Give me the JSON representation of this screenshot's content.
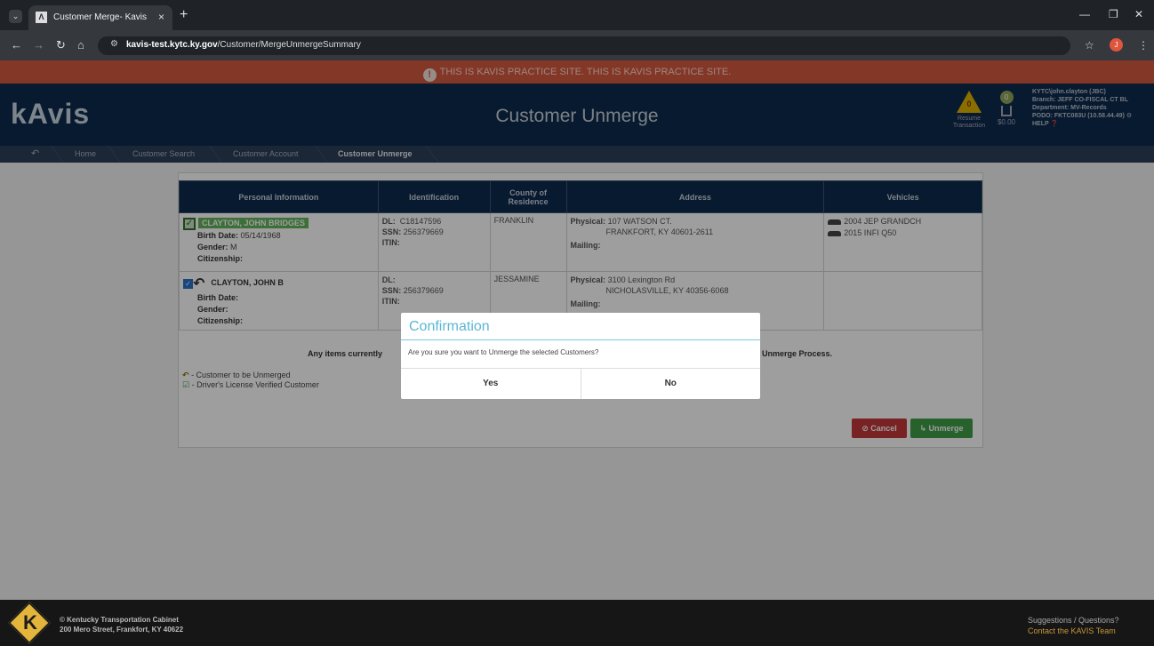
{
  "browser": {
    "tab_title": "Customer Merge- Kavis",
    "url_host": "kavis-test.kytc.ky.gov",
    "url_path": "/Customer/MergeUnmergeSummary"
  },
  "banner": {
    "practice_text": "THIS IS KAVIS PRACTICE SITE. THIS IS KAVIS PRACTICE SITE."
  },
  "header": {
    "logo": "kAvis",
    "title": "Customer Unmerge",
    "resume_count": "0",
    "resume_label_1": "Resume",
    "resume_label_2": "Transaction",
    "cart_count": "0",
    "cart_amount": "$0.00",
    "user_lines": [
      "KYTC\\john.clayton (JBC)",
      "Branch: JEFF CO-FISCAL CT BL",
      "Department: MV-Records",
      "PODO: FKTC083U (10.58.44.49) ⚙",
      "HELP ❓"
    ]
  },
  "breadcrumbs": {
    "items": [
      "Home",
      "Customer Search",
      "Customer Account",
      "Customer Unmerge"
    ]
  },
  "table": {
    "headers": [
      "Personal Information",
      "Identification",
      "County of Residence",
      "Address",
      "Vehicles"
    ],
    "rows": [
      {
        "name": "CLAYTON, JOHN BRIDGES",
        "birth_label": "Birth Date:",
        "birth_value": "05/14/1968",
        "gender_label": "Gender:",
        "gender_value": "M",
        "citizenship_label": "Citizenship:",
        "dl_label": "DL:",
        "dl_value": "C18147596",
        "ssn_label": "SSN:",
        "ssn_value": "256379669",
        "itin_label": "ITIN:",
        "county": "FRANKLIN",
        "physical_label": "Physical:",
        "physical_line1": "107 WATSON CT.",
        "physical_line2": "FRANKFORT, KY 40601-2611",
        "mailing_label": "Mailing:",
        "vehicles": [
          "2004 JEP GRANDCH",
          "2015 INFI Q50"
        ]
      },
      {
        "name": "CLAYTON, JOHN B",
        "birth_label": "Birth Date:",
        "gender_label": "Gender:",
        "citizenship_label": "Citizenship:",
        "dl_label": "DL:",
        "ssn_label": "SSN:",
        "ssn_value": "256379669",
        "itin_label": "ITIN:",
        "county": "JESSAMINE",
        "physical_label": "Physical:",
        "physical_line1": "3100 Lexington Rd",
        "physical_line2": "NICHOLASVILLE, KY 40356-6068",
        "mailing_label": "Mailing:"
      }
    ]
  },
  "notice": {
    "left": "Any items currently",
    "right": "Unmerge Process."
  },
  "legend": {
    "unmerge": "- Customer to be Unmerged",
    "verified": "- Driver's License Verified Customer"
  },
  "actions": {
    "cancel": "Cancel",
    "unmerge": "Unmerge"
  },
  "modal": {
    "title": "Confirmation",
    "message": "Are you sure you want to Unmerge the selected Customers?",
    "yes": "Yes",
    "no": "No"
  },
  "footer": {
    "org": "© Kentucky Transportation Cabinet",
    "address": "200 Mero Street, Frankfort, KY 40622",
    "suggestions": "Suggestions / Questions?",
    "contact": "Contact the KAVIS Team"
  },
  "colors": {
    "header_navy": "#0e2b4e",
    "practice_red": "#d4593f",
    "verified_green": "#63b45b",
    "cancel_red": "#c2383a",
    "unmerge_green": "#3f9e4a",
    "modal_title_blue": "#5bb7d3"
  }
}
